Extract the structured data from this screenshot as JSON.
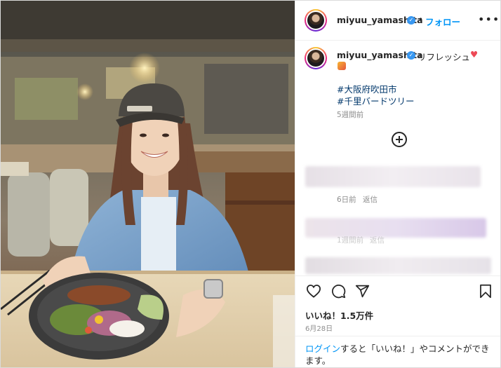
{
  "post": {
    "username": "miyuu_yamashita",
    "follow_label": "フォロー",
    "separator": "•",
    "more_label": "•••",
    "caption": "リフレッシュ",
    "caption_heart": "♥",
    "hashtags": [
      "#大阪府吹田市",
      "#千里バードツリー"
    ],
    "posted_ago": "5週間前",
    "verified_mark": "✓"
  },
  "comments": [
    {
      "time": "6日前",
      "reply_label": "返信"
    },
    {
      "time": "1週間前",
      "reply_label": "返信"
    }
  ],
  "actions": {
    "icons": [
      "heart-icon",
      "comment-icon",
      "share-icon",
      "bookmark-icon"
    ]
  },
  "stats": {
    "likes": "いいね！1.5万件",
    "date": "6月28日"
  },
  "footer": {
    "login_link": "ログイン",
    "login_text": "すると「いいね！」やコメントができます。"
  },
  "colors": {
    "accent": "#0095f6",
    "hashtag": "#00376b",
    "verified": "#3897f0",
    "muted": "#8e8e8e"
  }
}
